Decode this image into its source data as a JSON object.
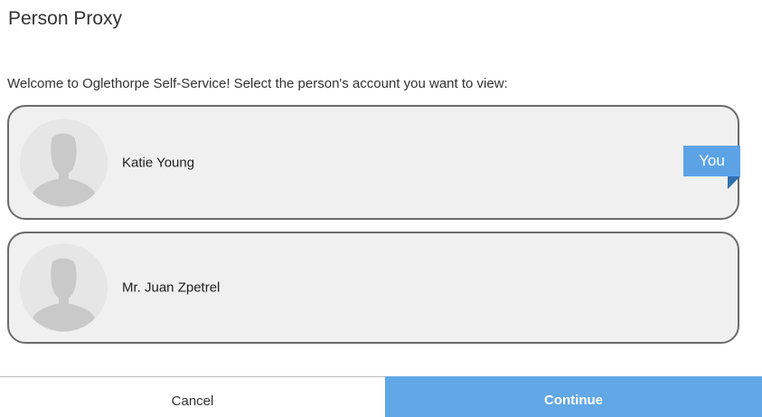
{
  "dialog": {
    "title": "Person Proxy",
    "intro": "Welcome to Oglethorpe Self-Service! Select the person's account you want to view:"
  },
  "persons": [
    {
      "name": "Katie Young",
      "badge": "You",
      "avatar_icon": "person-silhouette-icon"
    },
    {
      "name": "Mr. Juan Zpetrel",
      "avatar_icon": "person-silhouette-icon"
    }
  ],
  "footer": {
    "cancel_label": "Cancel",
    "continue_label": "Continue"
  },
  "colors": {
    "accent": "#5ca3e6",
    "badge_fold": "#2f6fae",
    "card_background": "#f0f0f0",
    "card_border": "#6b6b6b"
  }
}
